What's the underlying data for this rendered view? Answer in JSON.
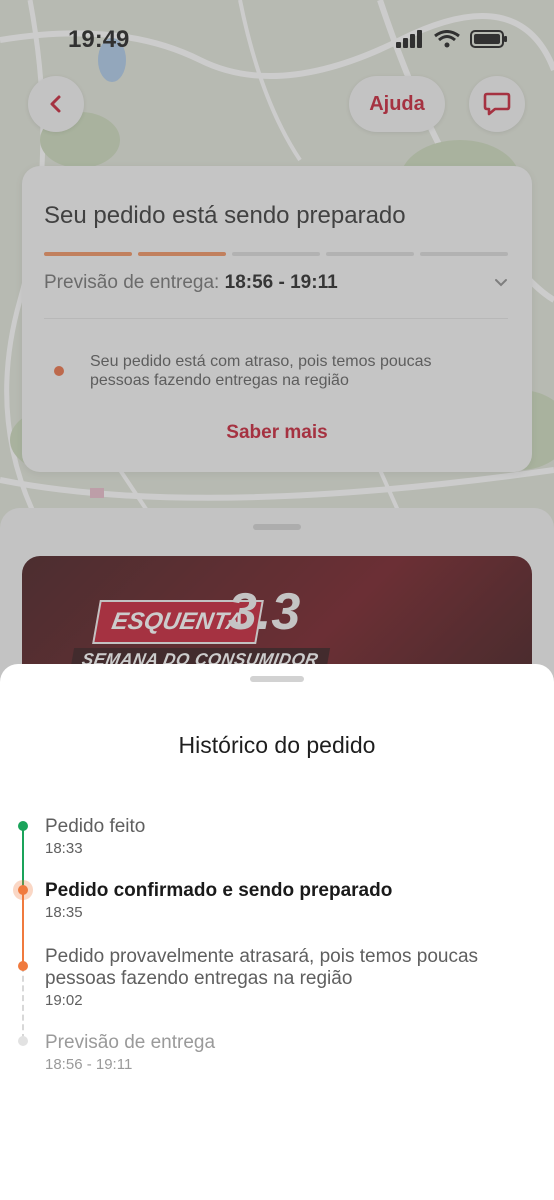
{
  "status_bar": {
    "time": "19:49"
  },
  "header": {
    "help_label": "Ajuda"
  },
  "status_card": {
    "title": "Seu pedido está sendo preparado",
    "progress": {
      "completed_segments": 2,
      "total_segments": 5
    },
    "eta_label": "Previsão de entrega:",
    "eta_value": "18:56 - 19:11",
    "delay_message": "Seu pedido está com atraso, pois temos poucas pessoas fazendo entregas na região",
    "learn_more": "Saber mais"
  },
  "banner": {
    "tag": "ESQUENTA",
    "number": "3.3",
    "subtitle": "SEMANA DO CONSUMIDOR"
  },
  "history": {
    "title": "Histórico do pedido",
    "events": [
      {
        "title": "Pedido feito",
        "time": "18:33",
        "status": "done"
      },
      {
        "title": "Pedido confirmado e sendo preparado",
        "time": "18:35",
        "status": "current"
      },
      {
        "title": "Pedido provavelmente atrasará, pois temos poucas pessoas fazendo entregas na região",
        "time": "19:02",
        "status": "done"
      },
      {
        "title": "Previsão de entrega",
        "time": "18:56 - 19:11",
        "status": "future"
      }
    ]
  },
  "colors": {
    "brand_red": "#c4132a",
    "progress_orange": "#ef8a57",
    "timeline_green": "#1aa35a",
    "timeline_orange": "#f07a3e"
  },
  "icons": {
    "back": "chevron-left-icon",
    "chat": "chat-bubble-icon",
    "eta_expand": "chevron-down-icon"
  }
}
